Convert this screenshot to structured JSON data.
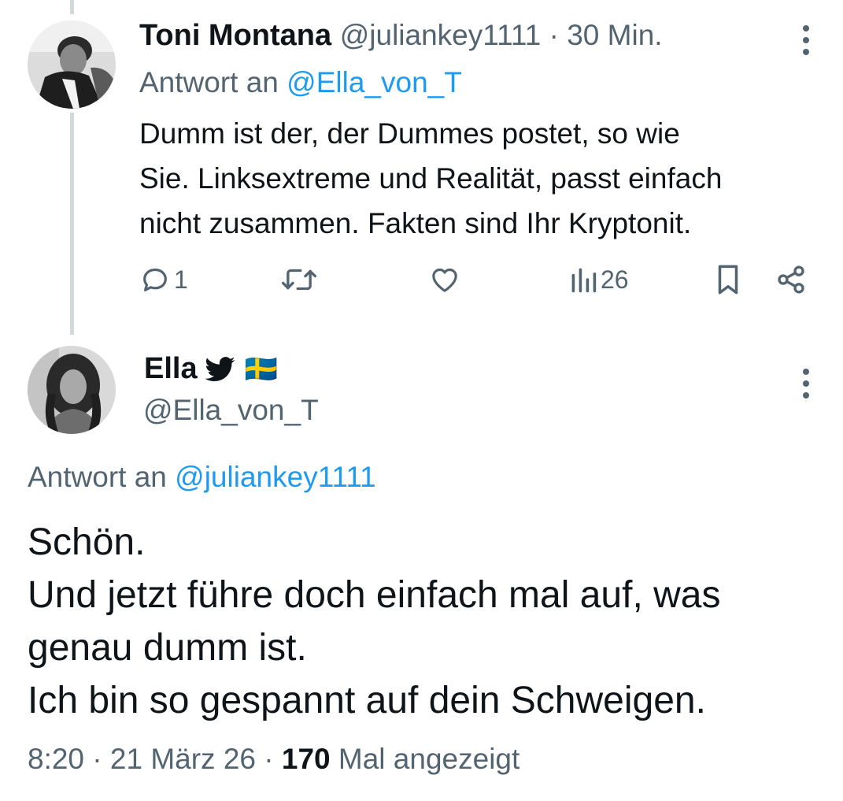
{
  "tweet1": {
    "name": "Toni Montana",
    "handle": "@juliankey1111",
    "separator": "·",
    "time": "30 Min.",
    "reply_prefix": "Antwort an",
    "reply_to": "@Ella_von_T",
    "body_lines": [
      "Dumm ist der, der Dummes postet, so wie",
      "Sie. Linksextreme und Realität, passt einfach",
      "nicht zusammen. Fakten sind Ihr Kryptonit."
    ],
    "actions": {
      "reply_count": "1",
      "views_count": "26"
    }
  },
  "tweet2": {
    "name": "Ella",
    "flag": "🇸🇪",
    "handle": "@Ella_von_T",
    "reply_prefix": "Antwort an",
    "reply_to": "@juliankey1111",
    "body_lines": [
      "Schön.",
      "Und jetzt führe doch einfach mal auf, was",
      "genau dumm ist.",
      "Ich bin so gespannt auf dein Schweigen."
    ],
    "footer": {
      "time": "8:20",
      "separator": "·",
      "date": "21 März 26",
      "views_number": "170",
      "views_label": "Mal angezeigt"
    }
  },
  "icons": {
    "reply": "reply-icon",
    "retweet": "retweet-icon",
    "like": "heart-icon",
    "views": "views-icon",
    "bookmark": "bookmark-icon",
    "share": "share-icon",
    "more": "more-icon",
    "bird": "bird-icon"
  },
  "colors": {
    "text": "#0f1419",
    "secondary": "#536471",
    "link": "#1d9bf0",
    "thread_line": "#cfd9de"
  }
}
